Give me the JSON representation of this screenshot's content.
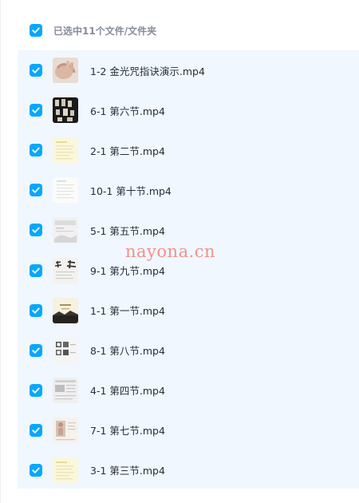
{
  "header": {
    "selection_text": "已选中11个文件/文件夹"
  },
  "files": [
    {
      "name": "1-2 金光咒指诀演示.mp4",
      "thumb": "hand-photo"
    },
    {
      "name": "6-1 第六节.mp4",
      "thumb": "dark-pattern"
    },
    {
      "name": "2-1 第二节.mp4",
      "thumb": "yellow-doc"
    },
    {
      "name": "10-1 第十节.mp4",
      "thumb": "white-doc"
    },
    {
      "name": "5-1 第五节.mp4",
      "thumb": "gray-doc"
    },
    {
      "name": "9-1 第九节.mp4",
      "thumb": "calligraphy"
    },
    {
      "name": "1-1 第一节.mp4",
      "thumb": "title-slide"
    },
    {
      "name": "8-1 第八节.mp4",
      "thumb": "seal-doc"
    },
    {
      "name": "4-1 第四节.mp4",
      "thumb": "text-doc"
    },
    {
      "name": "7-1 第七节.mp4",
      "thumb": "figure-doc"
    },
    {
      "name": "3-1 第三节.mp4",
      "thumb": "yellow-doc"
    }
  ],
  "watermark": "nayona.cn",
  "colors": {
    "accent": "#06a7ff",
    "list_background": "#f0f7fe"
  }
}
